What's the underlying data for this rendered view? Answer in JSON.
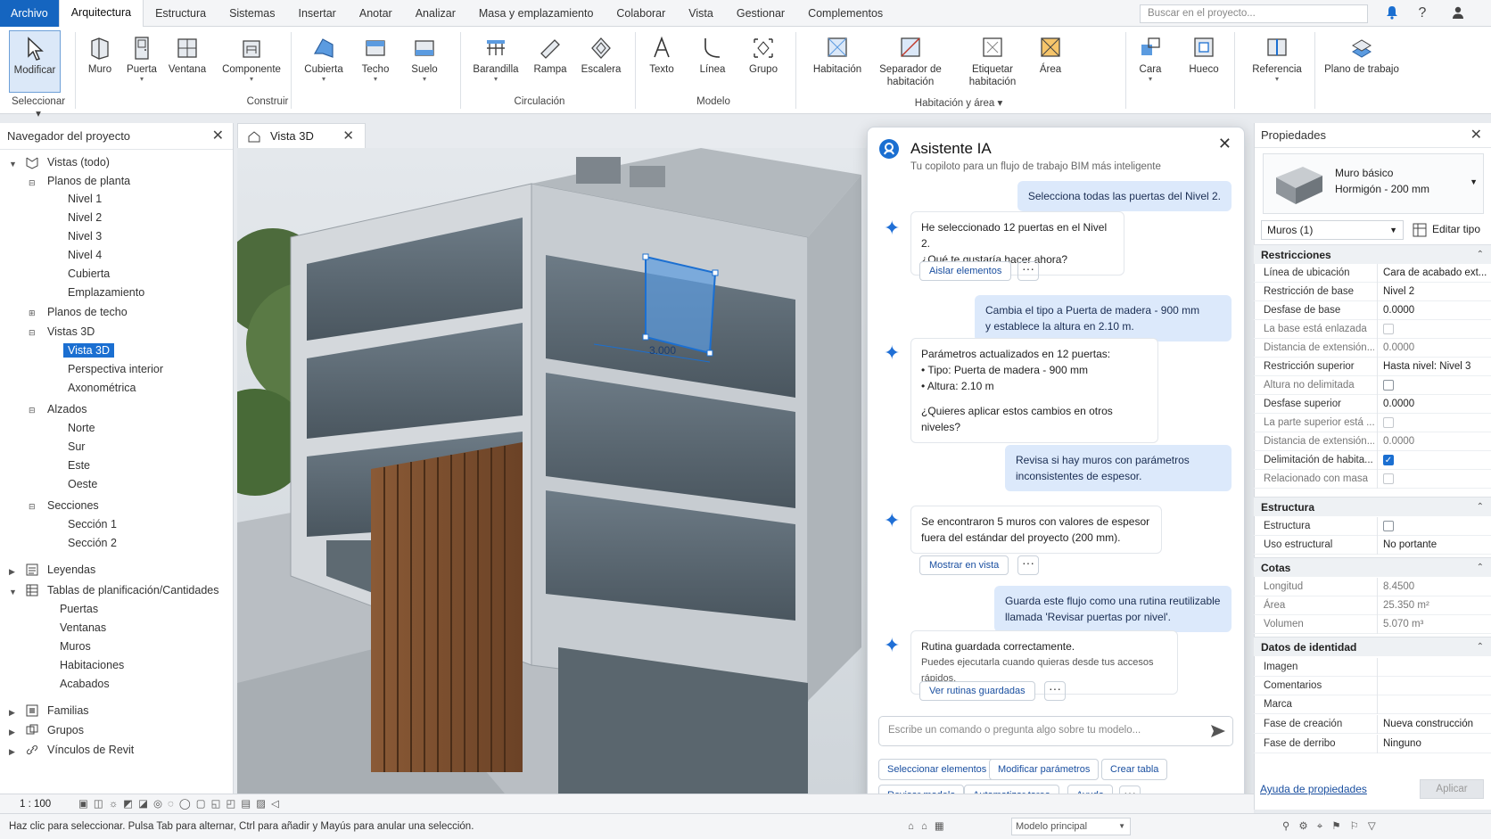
{
  "menu": {
    "file": "Archivo",
    "tabs": [
      "Arquitectura",
      "Estructura",
      "Sistemas",
      "Insertar",
      "Anotar",
      "Analizar",
      "Masa y emplazamiento",
      "Colaborar",
      "Vista",
      "Gestionar",
      "Complementos"
    ],
    "active_index": 0,
    "search_placeholder": "Buscar en el proyecto..."
  },
  "ribbon": {
    "modify": "Modificar",
    "select": "Seleccionar ▾",
    "buttons": [
      "Muro",
      "Puerta",
      "Ventana",
      "Componente",
      "Cubierta",
      "Techo",
      "Suelo",
      "Barandilla",
      "Rampa",
      "Escalera",
      "Texto",
      "Línea",
      "Grupo",
      "Habitación",
      "Separador de habitación",
      "Etiquetar habitación",
      "Área",
      "Cara",
      "Hueco",
      "Referencia",
      "Plano de trabajo"
    ],
    "groups": [
      "Construir",
      "Circulación",
      "Modelo",
      "Habitación y área ▾"
    ]
  },
  "browser": {
    "title": "Navegador del proyecto",
    "views_all": "Vistas (todo)",
    "floor_plans": "Planos de planta",
    "floor_items": [
      "Nivel 1",
      "Nivel 2",
      "Nivel 3",
      "Nivel 4",
      "Cubierta",
      "Emplazamiento"
    ],
    "ceiling_plans": "Planos de techo",
    "views3d": "Vistas 3D",
    "views3d_items": [
      "Vista 3D",
      "Perspectiva interior",
      "Axonométrica"
    ],
    "elevations": "Alzados",
    "elevation_items": [
      "Norte",
      "Sur",
      "Este",
      "Oeste"
    ],
    "sections": "Secciones",
    "section_items": [
      "Sección 1",
      "Sección 2"
    ],
    "legends": "Leyendas",
    "schedules": "Tablas de planificación/Cantidades",
    "schedule_items": [
      "Puertas",
      "Ventanas",
      "Muros",
      "Habitaciones",
      "Acabados"
    ],
    "families": "Familias",
    "groups": "Grupos",
    "links": "Vínculos de Revit"
  },
  "view": {
    "tab": "Vista 3D",
    "dimension": "3.000",
    "scale": "1 : 100"
  },
  "ai": {
    "title": "Asistente IA",
    "subtitle": "Tu copiloto para un flujo de trabajo BIM más inteligente",
    "u1": "Selecciona todas las puertas del Nivel 2.",
    "a1_l1": "He seleccionado 12 puertas en el Nivel 2.",
    "a1_l2": "¿Qué te gustaría hacer ahora?",
    "a1_btn": "Aislar elementos",
    "u2_l1": "Cambia el tipo a Puerta de madera - 900 mm",
    "u2_l2": "y establece la altura en 2.10 m.",
    "a2_l1": "Parámetros actualizados en 12 puertas:",
    "a2_l2": "• Tipo: Puerta de madera - 900 mm",
    "a2_l3": "• Altura: 2.10 m",
    "a2_l4": "¿Quieres aplicar estos cambios en otros niveles?",
    "u3_l1": "Revisa si hay muros con parámetros",
    "u3_l2": "inconsistentes de espesor.",
    "a3_l1": "Se encontraron 5 muros con valores de espesor",
    "a3_l2": "fuera del estándar del proyecto (200 mm).",
    "a3_btn": "Mostrar en vista",
    "u4_l1": "Guarda este flujo como una rutina reutilizable",
    "u4_l2": "llamada 'Revisar puertas por nivel'.",
    "a4_l1": "Rutina guardada correctamente.",
    "a4_l2": "Puedes ejecutarla cuando quieras desde tus accesos rápidos.",
    "a4_btn": "Ver rutinas guardadas",
    "input_placeholder": "Escribe un comando o pregunta algo sobre tu modelo...",
    "suggestions": [
      "Seleccionar elementos",
      "Modificar parámetros",
      "Crear tabla",
      "Revisar modelo",
      "Automatizar tarea",
      "Ayuda"
    ]
  },
  "props": {
    "title": "Propiedades",
    "type_family": "Muro básico",
    "type_name": "Hormigón - 200 mm",
    "filter": "Muros (1)",
    "edit_type": "Editar tipo",
    "sec_constraints": "Restricciones",
    "location_line": "Línea de ubicación",
    "location_line_v": "Cara de acabado ext...",
    "base_constraint": "Restricción de base",
    "base_constraint_v": "Nivel 2",
    "base_offset": "Desfase de base",
    "base_offset_v": "0.0000",
    "base_attached": "La base está enlazada",
    "base_ext": "Distancia de extensión...",
    "base_ext_v": "0.0000",
    "top_constraint": "Restricción superior",
    "top_constraint_v": "Hasta nivel: Nivel 3",
    "unconnected": "Altura no delimitada",
    "top_offset": "Desfase superior",
    "top_offset_v": "0.0000",
    "top_attached": "La parte superior está ...",
    "top_ext": "Distancia de extensión...",
    "top_ext_v": "0.0000",
    "room_bounding": "Delimitación de habita...",
    "mass_related": "Relacionado con masa",
    "sec_structure": "Estructura",
    "structural": "Estructura",
    "structural_usage": "Uso estructural",
    "structural_usage_v": "No portante",
    "sec_dimensions": "Cotas",
    "length": "Longitud",
    "length_v": "8.4500",
    "area": "Área",
    "area_v": "25.350 m²",
    "volume": "Volumen",
    "volume_v": "5.070 m³",
    "sec_identity": "Datos de identidad",
    "image": "Imagen",
    "comments": "Comentarios",
    "mark": "Marca",
    "phase_created": "Fase de creación",
    "phase_created_v": "Nueva construcción",
    "phase_demolished": "Fase de derribo",
    "phase_demolished_v": "Ninguno",
    "help": "Ayuda de propiedades",
    "apply": "Aplicar"
  },
  "status": {
    "hint": "Haz clic para seleccionar. Pulsa Tab para alternar, Ctrl para añadir y Mayús para anular una selección.",
    "model": "Modelo principal"
  },
  "colors": {
    "accent": "#1b6fd1",
    "file_tab": "#1565c0",
    "user_bubble": "#dce9fb"
  }
}
